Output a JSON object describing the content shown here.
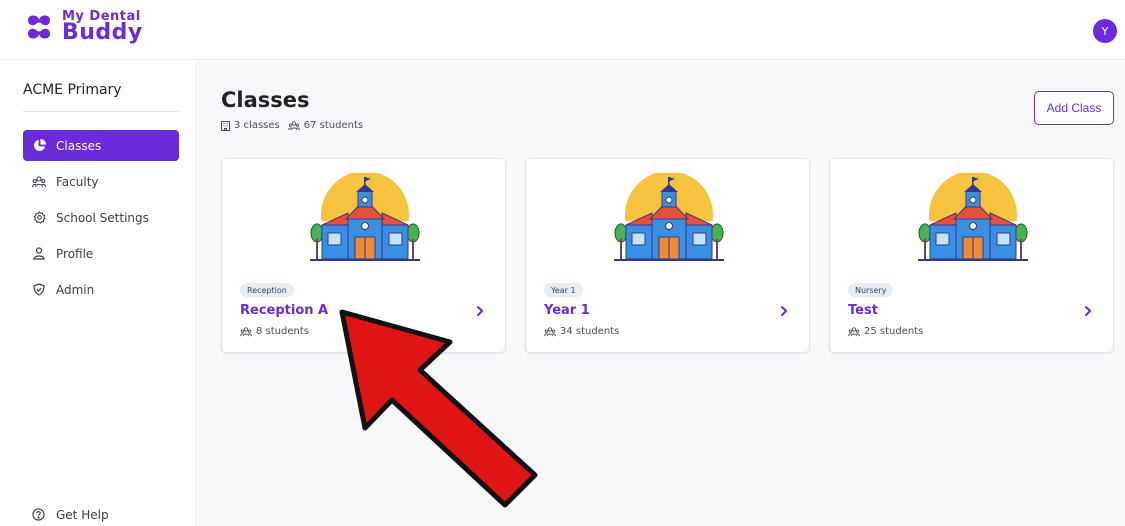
{
  "app": {
    "logo_line1": "My Dental",
    "logo_line2": "Buddy",
    "avatar_initial": "Y",
    "brand_color": "#6b2bd9"
  },
  "sidebar": {
    "school_name": "ACME Primary",
    "items": [
      {
        "label": "Classes",
        "icon": "pie-chart-icon",
        "active": true
      },
      {
        "label": "Faculty",
        "icon": "people-icon",
        "active": false
      },
      {
        "label": "School Settings",
        "icon": "gear-icon",
        "active": false
      },
      {
        "label": "Profile",
        "icon": "user-icon",
        "active": false
      },
      {
        "label": "Admin",
        "icon": "shield-icon",
        "active": false
      }
    ],
    "help_label": "Get Help"
  },
  "main": {
    "title": "Classes",
    "classes_count": "3 classes",
    "students_count": "67 students",
    "add_button": "Add Class",
    "cards": [
      {
        "badge": "Reception",
        "title": "Reception A",
        "students": "8 students"
      },
      {
        "badge": "Year 1",
        "title": "Year 1",
        "students": "34 students"
      },
      {
        "badge": "Nursery",
        "title": "Test",
        "students": "25 students"
      }
    ]
  },
  "annotation": {
    "arrow_color": "#e01414"
  }
}
